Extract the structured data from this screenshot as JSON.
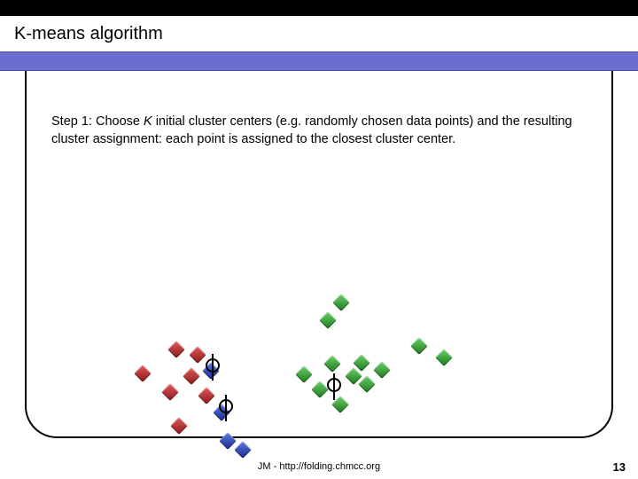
{
  "slide": {
    "title": "K-means algorithm",
    "step_label": "Step 1: Choose ",
    "step_italic": "K",
    "step_rest": " initial cluster centers (e.g. randomly chosen data points) and the resulting cluster assignment: each point is assigned to the closest cluster center."
  },
  "footer": {
    "credit": "JM - http://folding.chmcc.org",
    "page": "13"
  },
  "chart_data": {
    "type": "scatter",
    "title": "",
    "xlabel": "",
    "ylabel": "",
    "xlim": [
      0,
      420
    ],
    "ylim": [
      0,
      220
    ],
    "series": [
      {
        "name": "red",
        "points": [
          {
            "x": 31,
            "y": 127
          },
          {
            "x": 69,
            "y": 100
          },
          {
            "x": 93,
            "y": 106
          },
          {
            "x": 86,
            "y": 130
          },
          {
            "x": 62,
            "y": 148
          },
          {
            "x": 103,
            "y": 152
          },
          {
            "x": 72,
            "y": 186
          }
        ]
      },
      {
        "name": "blue",
        "points": [
          {
            "x": 108,
            "y": 124
          },
          {
            "x": 120,
            "y": 171
          },
          {
            "x": 127,
            "y": 203
          },
          {
            "x": 144,
            "y": 213
          }
        ]
      },
      {
        "name": "green",
        "points": [
          {
            "x": 213,
            "y": 128
          },
          {
            "x": 231,
            "y": 145
          },
          {
            "x": 245,
            "y": 116
          },
          {
            "x": 254,
            "y": 162
          },
          {
            "x": 269,
            "y": 130
          },
          {
            "x": 284,
            "y": 139
          },
          {
            "x": 278,
            "y": 115
          },
          {
            "x": 301,
            "y": 123
          },
          {
            "x": 240,
            "y": 67
          },
          {
            "x": 255,
            "y": 47
          },
          {
            "x": 343,
            "y": 96
          },
          {
            "x": 371,
            "y": 109
          }
        ]
      }
    ],
    "centers": [
      {
        "name": "center-red",
        "x": 110,
        "y": 118
      },
      {
        "name": "center-blue",
        "x": 125,
        "y": 164
      },
      {
        "name": "center-green",
        "x": 247,
        "y": 140
      }
    ]
  }
}
